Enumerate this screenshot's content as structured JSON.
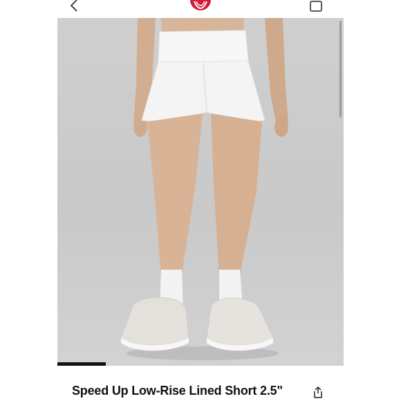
{
  "header": {
    "back_icon": "chevron-left-icon",
    "logo": "lululemon-logo",
    "bag_icon": "shopping-bag-icon",
    "brand_color": "#d31c38"
  },
  "product": {
    "image_description_icon": "product-photo",
    "gallery_progress": 0.17,
    "title": "Speed Up Low-Rise Lined Short 2.5\"",
    "share_icon": "share-icon"
  }
}
